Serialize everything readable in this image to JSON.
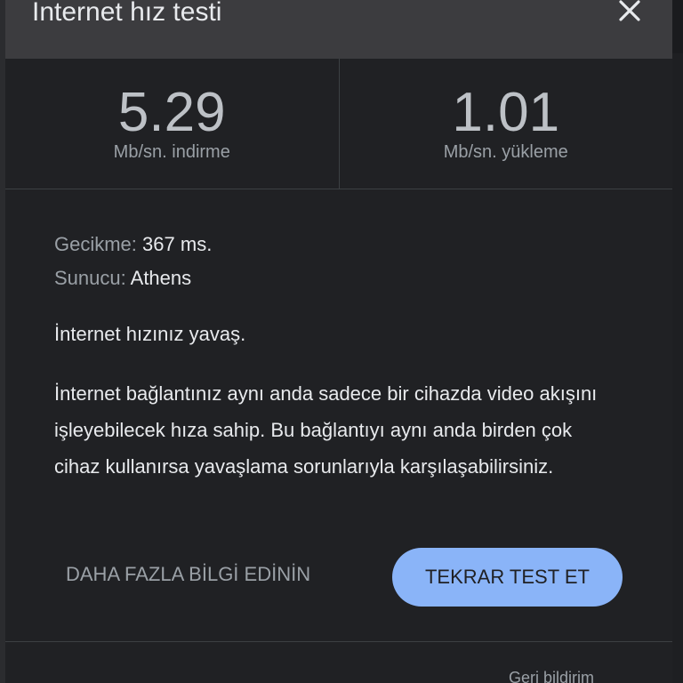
{
  "dialog": {
    "title": "İnternet hız testi",
    "close_icon": "close-icon"
  },
  "speeds": {
    "download": {
      "value": "5.29",
      "unit": "Mb/sn. indirme"
    },
    "upload": {
      "value": "1.01",
      "unit": "Mb/sn. yükleme"
    }
  },
  "info": {
    "latency_label": "Gecikme:",
    "latency_value": "367 ms.",
    "server_label": "Sunucu:",
    "server_value": "Athens"
  },
  "verdict": "İnternet hızınız yavaş.",
  "description": "İnternet bağlantınız aynı anda sadece bir cihazda video akışını işleyebilecek hıza sahip. Bu bağlantıyı aynı anda birden çok cihaz kullanırsa yavaşlama sorunlarıyla karşılaşabilirsiniz.",
  "actions": {
    "learn_more": "DAHA FAZLA BİLGİ EDİNİN",
    "retest": "TEKRAR TEST ET"
  },
  "footer": {
    "text": "Geri bildirim"
  },
  "colors": {
    "accent": "#8ab4f8",
    "background": "#202124",
    "titlebar": "#3c3c3f"
  }
}
